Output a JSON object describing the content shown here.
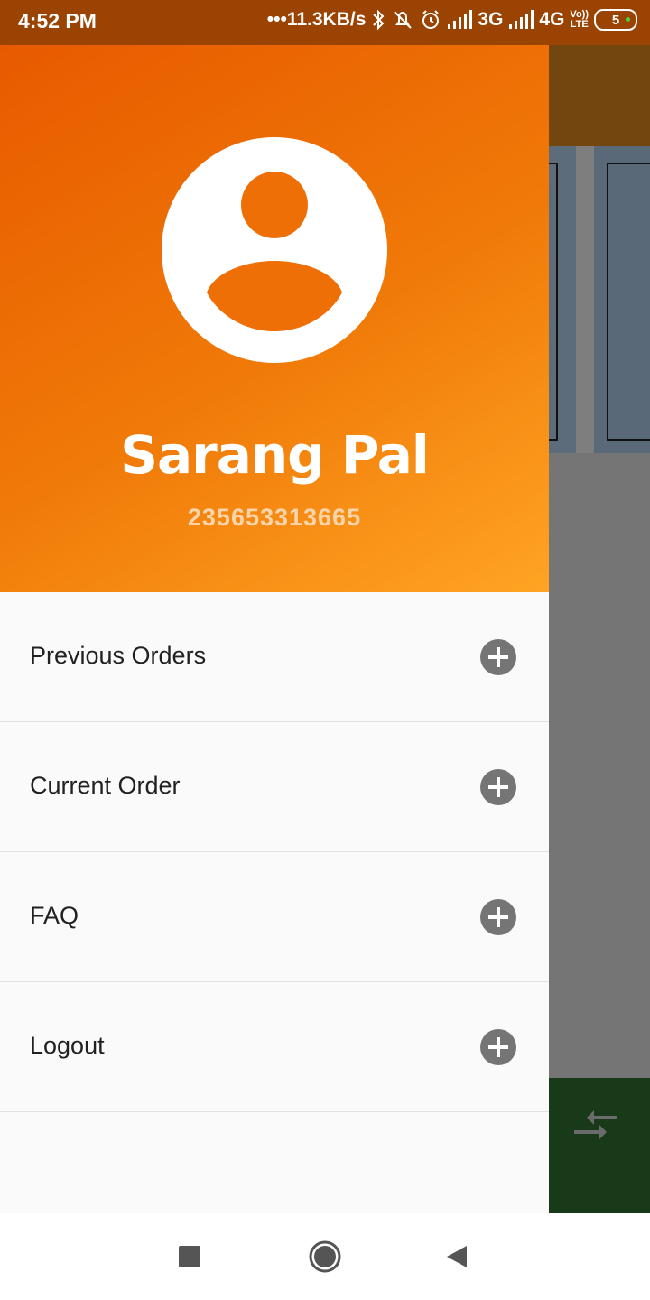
{
  "status_bar": {
    "time": "4:52 PM",
    "speed": "•••11.3KB/s",
    "network1": "3G",
    "network2": "4G",
    "volte_top": "Vo))",
    "volte_bottom": "LTE",
    "battery": "5"
  },
  "drawer": {
    "user_name": "Sarang Pal",
    "user_phone": "235653313665",
    "menu_items": [
      {
        "label": "Previous Orders",
        "icon": "plus-circle-icon"
      },
      {
        "label": "Current Order",
        "icon": "plus-circle-icon"
      },
      {
        "label": "FAQ",
        "icon": "plus-circle-icon"
      },
      {
        "label": "Logout",
        "icon": "plus-circle-icon"
      }
    ]
  },
  "colors": {
    "header_gradient_start": "#e85a00",
    "header_gradient_end": "#ffa424",
    "status_bar": "#9a4303",
    "menu_icon": "#757575"
  },
  "navigation_bar": {
    "recent_icon": "square-icon",
    "home_icon": "circle-icon",
    "back_icon": "triangle-back-icon"
  }
}
